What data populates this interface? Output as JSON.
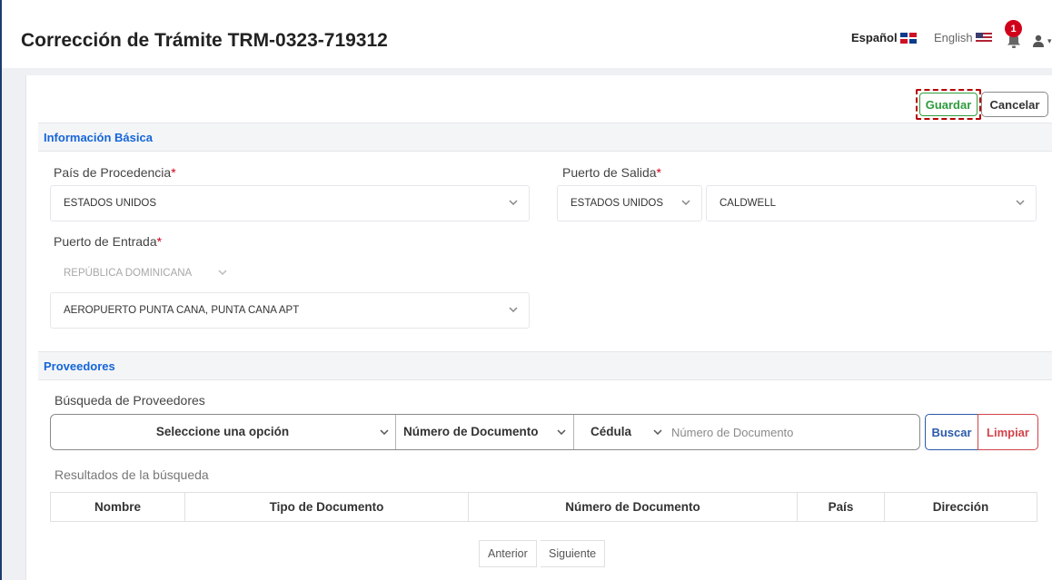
{
  "header": {
    "title": "Corrección de Trámite TRM-0323-719312",
    "lang_es": "Español",
    "lang_en": "English",
    "notification_count": "1"
  },
  "actions": {
    "save_label": "Guardar",
    "cancel_label": "Cancelar"
  },
  "basic_info": {
    "section_title": "Información Básica",
    "origin_country": {
      "label": "País de Procedencia",
      "value": "ESTADOS UNIDOS"
    },
    "exit_port": {
      "label": "Puerto de Salida",
      "country_value": "ESTADOS UNIDOS",
      "port_value": "CALDWELL"
    },
    "entry_port": {
      "label": "Puerto de Entrada",
      "country_value": "REPÚBLICA DOMINICANA",
      "port_value": "AEROPUERTO PUNTA CANA, PUNTA CANA APT"
    },
    "required_mark": "*"
  },
  "providers": {
    "section_title": "Proveedores",
    "search_label": "Búsqueda de Proveedores",
    "option_select": "Seleccione una opción",
    "doc_type_select": "Número de Documento",
    "id_type_select": "Cédula",
    "doc_input_placeholder": "Número de Documento",
    "search_button": "Buscar",
    "clear_button": "Limpiar",
    "results_label": "Resultados de la búsqueda",
    "columns": [
      "Nombre",
      "Tipo de Documento",
      "Número de Documento",
      "País",
      "Dirección"
    ],
    "pager_prev": "Anterior",
    "pager_next": "Siguiente"
  },
  "colors": {
    "accent_blue": "#1565d8",
    "save_green": "#2e9b3c",
    "clear_red": "#d0434a",
    "required_red": "#d0021b"
  }
}
